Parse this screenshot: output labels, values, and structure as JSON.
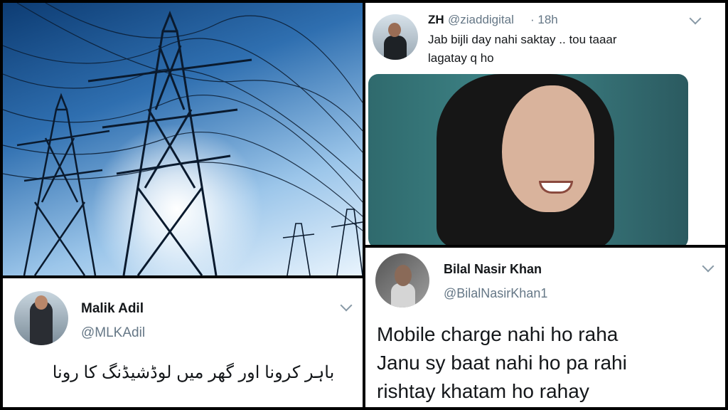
{
  "malik_tweet": {
    "name": "Malik Adil",
    "handle": "@MLKAdil",
    "text": "باہر کرونا اور گھر میں لوڈشیڈنگ کا رونا"
  },
  "zh_tweet": {
    "name": "ZH",
    "handle": "@ziaddigital",
    "time": "· 18h",
    "text_line1": "Jab bijli day nahi saktay .. tou taaar",
    "text_line2": "lagatay q ho"
  },
  "bilal_tweet": {
    "name": "Bilal Nasir Khan",
    "handle": "@BilalNasirKhan1",
    "line1": "Mobile charge nahi ho raha",
    "line2": "Janu sy baat nahi ho pa rahi",
    "line3": "rishtay khatam ho rahay"
  },
  "icons": {
    "more": "chevron-down-icon"
  }
}
